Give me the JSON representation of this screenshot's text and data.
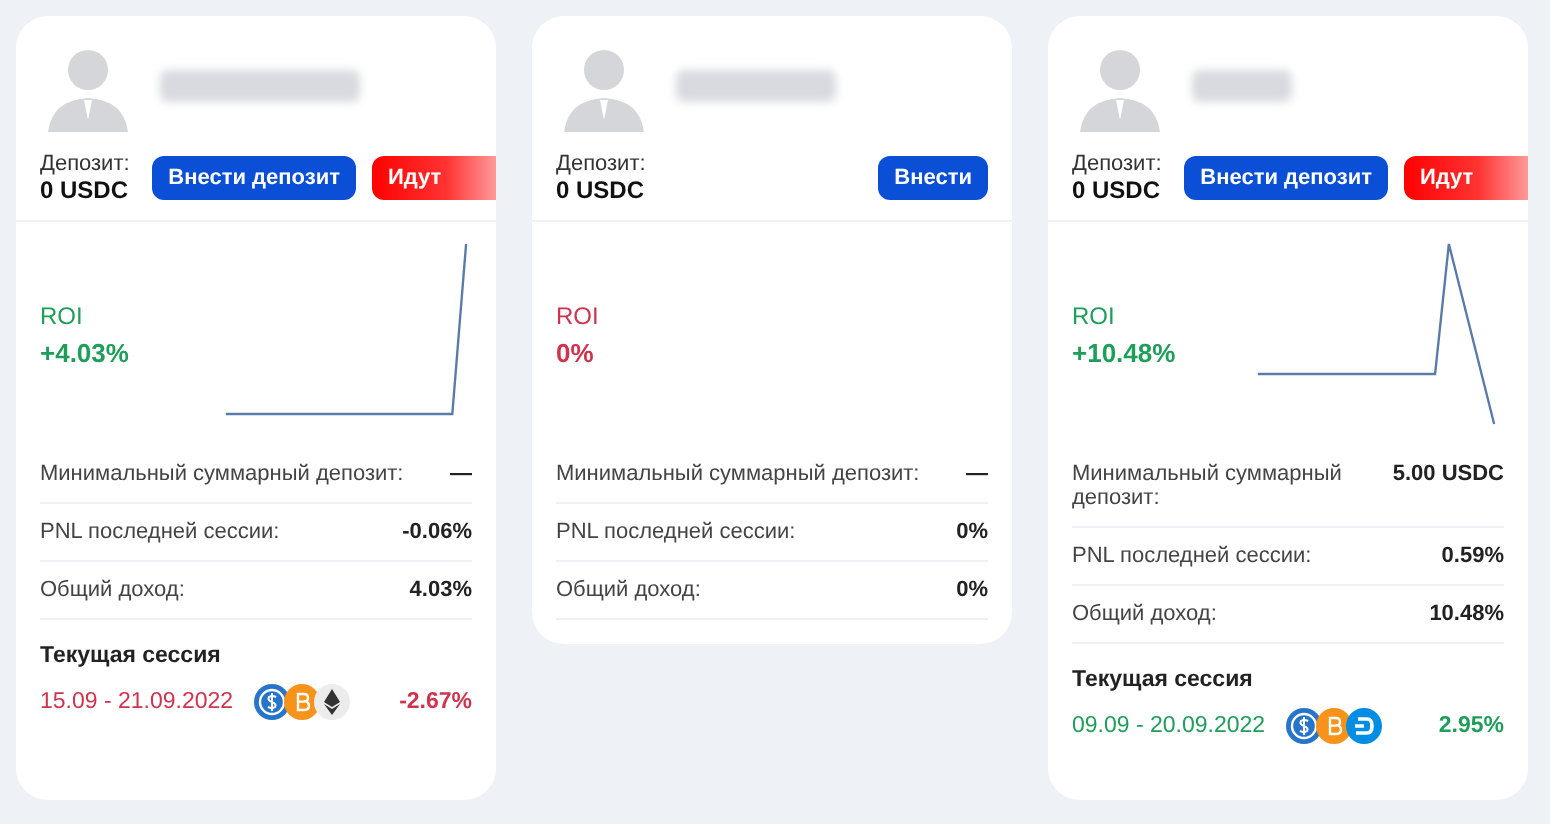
{
  "cards": [
    {
      "deposit_label": "Депозит:",
      "deposit_value": "0 USDC",
      "buttons": [
        {
          "label": "Внести депозит",
          "kind": "primary"
        },
        {
          "label": "Идут",
          "kind": "danger"
        }
      ],
      "roi": {
        "label": "ROI",
        "value": "+4.03%",
        "color": "#1f9e5a"
      },
      "sparkline": {
        "kind": "rise"
      },
      "stats": [
        {
          "label": "Минимальный суммарный депозит:",
          "value": "—"
        },
        {
          "label": "PNL последней сессии:",
          "value": "-0.06%"
        },
        {
          "label": "Общий доход:",
          "value": "4.03%"
        }
      ],
      "session": {
        "title": "Текущая сессия",
        "dates": "15.09 - 21.09.2022",
        "coins": [
          {
            "kind": "usdc"
          },
          {
            "kind": "btc"
          },
          {
            "kind": "eth"
          }
        ],
        "result": "-2.67%",
        "color": "#d0334e"
      }
    },
    {
      "deposit_label": "Депозит:",
      "deposit_value": "0 USDC",
      "buttons": [
        {
          "label": "Внести",
          "kind": "primary"
        }
      ],
      "roi": {
        "label": "ROI",
        "value": "0%",
        "color": "#d0334e"
      },
      "stats": [
        {
          "label": "Минимальный суммарный депозит:",
          "value": "—"
        },
        {
          "label": "PNL последней сессии:",
          "value": "0%"
        },
        {
          "label": "Общий доход:",
          "value": "0%"
        }
      ]
    },
    {
      "deposit_label": "Депозит:",
      "deposit_value": "0 USDC",
      "buttons": [
        {
          "label": "Внести депозит",
          "kind": "primary"
        },
        {
          "label": "Идут",
          "kind": "danger"
        }
      ],
      "roi": {
        "label": "ROI",
        "value": "+10.48%",
        "color": "#1f9e5a"
      },
      "sparkline": {
        "kind": "spike"
      },
      "stats": [
        {
          "label": "Минимальный суммарный депозит:",
          "value": "5.00 USDC"
        },
        {
          "label": "PNL последней сессии:",
          "value": "0.59%"
        },
        {
          "label": "Общий доход:",
          "value": "10.48%"
        }
      ],
      "session": {
        "title": "Текущая сессия",
        "dates": "09.09 - 20.09.2022",
        "coins": [
          {
            "kind": "usdc"
          },
          {
            "kind": "btc"
          },
          {
            "kind": "dash"
          }
        ],
        "result": "2.95%",
        "color": "#1f9e5a"
      }
    }
  ]
}
